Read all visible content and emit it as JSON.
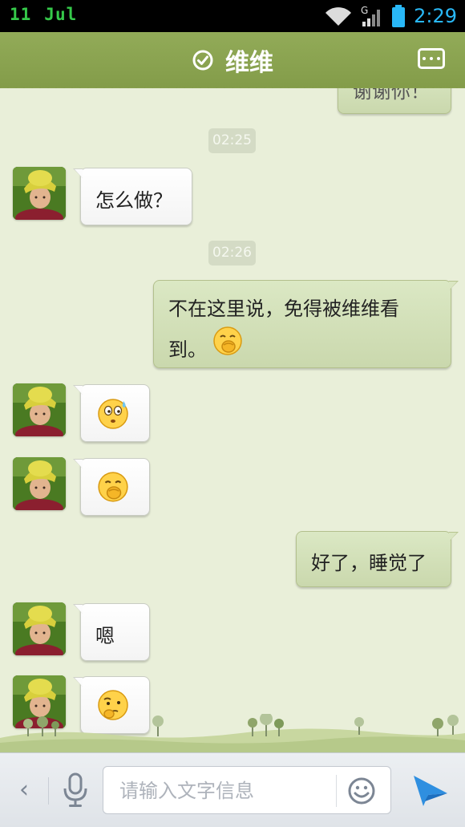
{
  "status_bar": {
    "day": "11",
    "month": "Jul",
    "network": "G",
    "time": "2:29"
  },
  "header": {
    "title": "维维",
    "verified_icon": "check-circle-icon",
    "menu_icon": "more-dots-icon"
  },
  "messages": [
    {
      "side": "right",
      "type": "text",
      "text": "谢谢你！",
      "partially_visible": true
    },
    {
      "side": "center",
      "type": "time",
      "text": "02:25"
    },
    {
      "side": "left",
      "type": "text",
      "text": "怎么做？"
    },
    {
      "side": "center",
      "type": "time",
      "text": "02:26"
    },
    {
      "side": "right",
      "type": "text",
      "line1": "不在这里说，免得被维维看",
      "line2": "到。",
      "emoji": "covering-mouth-face"
    },
    {
      "side": "left",
      "type": "emoji",
      "emoji": "nervous-sweat-face"
    },
    {
      "side": "left",
      "type": "emoji",
      "emoji": "covering-mouth-face"
    },
    {
      "side": "right",
      "type": "text",
      "text": "好了，睡觉了"
    },
    {
      "side": "left",
      "type": "text",
      "text": "嗯"
    },
    {
      "side": "left",
      "type": "emoji",
      "emoji": "thinking-face"
    }
  ],
  "input_bar": {
    "back_icon": "chevron-left-icon",
    "voice_icon": "microphone-icon",
    "placeholder": "请输入文字信息",
    "value": "",
    "emoji_icon": "smiley-icon",
    "send_icon": "send-icon"
  },
  "colors": {
    "header": "#8aa34f",
    "background": "#e9efd9",
    "outgoing_bubble": "#d3e0b8",
    "incoming_bubble": "#ffffff",
    "time_accent": "#29b8f7"
  }
}
